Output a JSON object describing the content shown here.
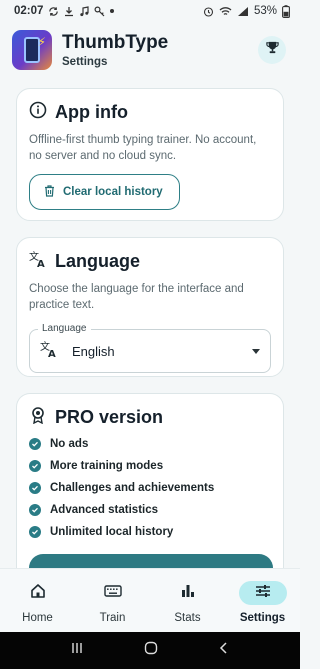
{
  "status": {
    "time": "02:07",
    "battery": "53%"
  },
  "header": {
    "title": "ThumbType",
    "subtitle": "Settings"
  },
  "app_info": {
    "title": "App info",
    "description": "Offline-first thumb typing trainer. No account, no server and no cloud sync.",
    "clear_button": "Clear local history"
  },
  "language": {
    "title": "Language",
    "description": "Choose the language for the interface and practice text.",
    "field_label": "Language",
    "selected": "English"
  },
  "pro": {
    "title": "PRO version",
    "features": [
      "No ads",
      "More training modes",
      "Challenges and achievements",
      "Advanced statistics",
      "Unlimited local history"
    ]
  },
  "nav": {
    "items": [
      {
        "label": "Home",
        "icon": "home-icon"
      },
      {
        "label": "Train",
        "icon": "keyboard-icon"
      },
      {
        "label": "Stats",
        "icon": "bar-chart-icon"
      },
      {
        "label": "Settings",
        "icon": "sliders-icon"
      }
    ],
    "active": "Settings"
  },
  "colors": {
    "accent": "#2e7a83",
    "active_nav": "#b7ecf0",
    "background": "#f4f7f8"
  }
}
